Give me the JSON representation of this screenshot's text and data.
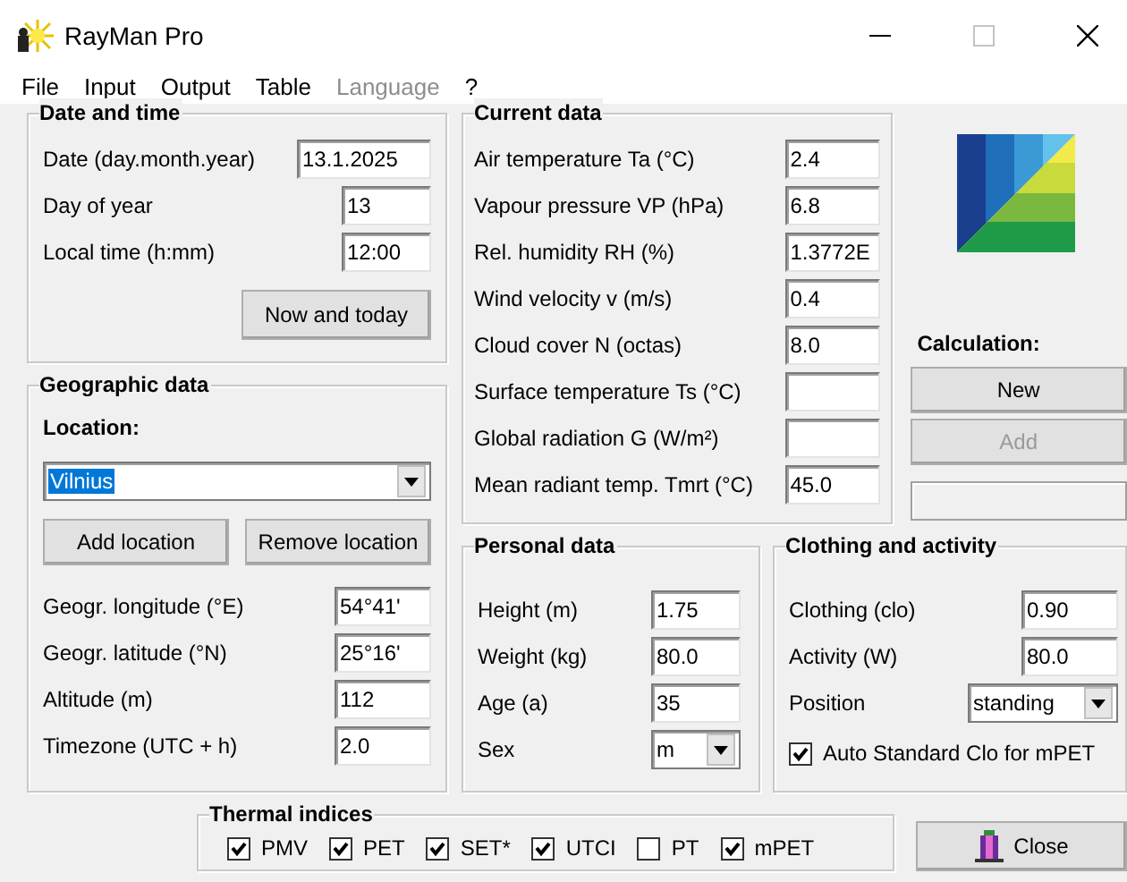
{
  "window": {
    "title": "RayMan Pro"
  },
  "menu": [
    {
      "label": "File",
      "disabled": false
    },
    {
      "label": "Input",
      "disabled": false
    },
    {
      "label": "Output",
      "disabled": false
    },
    {
      "label": "Table",
      "disabled": false
    },
    {
      "label": "Language",
      "disabled": true
    },
    {
      "label": "?",
      "disabled": false
    }
  ],
  "date_time": {
    "title": "Date and time",
    "fields": [
      {
        "label": "Date (day.month.year)",
        "value": "13.1.2025",
        "kind": "wide"
      },
      {
        "label": "Day of year",
        "value": "13",
        "kind": "text"
      },
      {
        "label": "Local time (h:mm)",
        "value": "12:00",
        "kind": "text"
      }
    ],
    "button": "Now and today"
  },
  "geographic": {
    "title": "Geographic data",
    "location_label": "Location:",
    "location": {
      "value": "Vilnius",
      "highlighted": true
    },
    "buttons": [
      "Add location",
      "Remove location"
    ],
    "fields": [
      {
        "label": "Geogr. longitude (°E)",
        "value": "54°41'"
      },
      {
        "label": "Geogr. latitude (°N)",
        "value": "25°16'"
      },
      {
        "label": "Altitude (m)",
        "value": "112"
      },
      {
        "label": "Timezone (UTC + h)",
        "value": "2.0"
      }
    ]
  },
  "current_data": {
    "title": "Current data",
    "fields": [
      {
        "label": "Air temperature Ta (°C)",
        "value": "2.4"
      },
      {
        "label": "Vapour pressure VP (hPa)",
        "value": "6.8"
      },
      {
        "label": "Rel. humidity RH (%)",
        "value": "1.3772E"
      },
      {
        "label": "Wind velocity v (m/s)",
        "value": "0.4"
      },
      {
        "label": "Cloud cover N (octas)",
        "value": "8.0"
      },
      {
        "label": "Surface temperature Ts (°C)"
      },
      {
        "label": "Global radiation G (W/m²)"
      },
      {
        "label": "Mean radiant temp. Tmrt (°C)",
        "value": "45.0"
      }
    ]
  },
  "calculation": {
    "label": "Calculation:",
    "buttons": [
      {
        "label": "New",
        "disabled": false
      },
      {
        "label": "Add",
        "disabled": true
      }
    ]
  },
  "personal_data": {
    "title": "Personal data",
    "fields": [
      {
        "label": "Height (m)",
        "value": "1.75",
        "kind": "text"
      },
      {
        "label": "Weight (kg)",
        "value": "80.0",
        "kind": "text"
      },
      {
        "label": "Age (a)",
        "value": "35",
        "kind": "text"
      },
      {
        "label": "Sex",
        "value": "m",
        "kind": "select"
      }
    ]
  },
  "clothing_activity": {
    "title": "Clothing and activity",
    "fields": [
      {
        "label": "Clothing (clo)",
        "value": "0.90",
        "kind": "text"
      },
      {
        "label": "Activity (W)",
        "value": "80.0",
        "kind": "text"
      },
      {
        "label": "Position",
        "value": "standing",
        "kind": "select"
      }
    ],
    "checkbox": {
      "label": "Auto Standard Clo for mPET",
      "checked": true
    }
  },
  "thermal_indices": {
    "title": "Thermal indices",
    "items": [
      {
        "label": "PMV",
        "checked": true
      },
      {
        "label": "PET",
        "checked": true
      },
      {
        "label": "SET*",
        "checked": true
      },
      {
        "label": "UTCI",
        "checked": true
      },
      {
        "label": "PT",
        "checked": false
      },
      {
        "label": "mPET",
        "checked": true
      }
    ]
  },
  "close_button": "Close"
}
